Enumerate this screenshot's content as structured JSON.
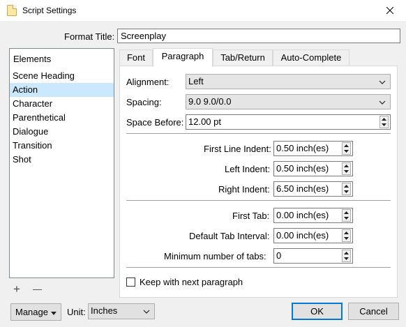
{
  "window": {
    "title": "Script Settings"
  },
  "format_title": {
    "label": "Format Title:",
    "value": "Screenplay"
  },
  "elements": {
    "header": "Elements",
    "items": [
      "Scene Heading",
      "Action",
      "Character",
      "Parenthetical",
      "Dialogue",
      "Transition",
      "Shot"
    ],
    "selected": "Action",
    "add_symbol": "+",
    "remove_symbol": "—"
  },
  "tabs": [
    "Font",
    "Paragraph",
    "Tab/Return",
    "Auto-Complete"
  ],
  "active_tab": "Paragraph",
  "paragraph": {
    "alignment_label": "Alignment:",
    "alignment_value": "Left",
    "spacing_label": "Spacing:",
    "spacing_value": "9.0 9.0/0.0",
    "space_before_label": "Space Before:",
    "space_before_value": "12.00 pt",
    "first_line_indent_label": "First Line Indent:",
    "first_line_indent_value": "0.50 inch(es)",
    "left_indent_label": "Left Indent:",
    "left_indent_value": "0.50 inch(es)",
    "right_indent_label": "Right Indent:",
    "right_indent_value": "6.50 inch(es)",
    "first_tab_label": "First Tab:",
    "first_tab_value": "0.00 inch(es)",
    "default_tab_interval_label": "Default Tab Interval:",
    "default_tab_interval_value": "0.00 inch(es)",
    "min_tabs_label": "Minimum number of tabs:",
    "min_tabs_value": "0",
    "keep_with_next_label": "Keep with next paragraph",
    "keep_with_next_checked": false
  },
  "footer": {
    "manage_label": "Manage",
    "unit_label": "Unit:",
    "unit_value": "Inches",
    "ok_label": "OK",
    "cancel_label": "Cancel"
  },
  "colors": {
    "selection": "#cce8ff",
    "default_button_border": "#0078d7",
    "dialog_background": "#f0f0f0"
  }
}
